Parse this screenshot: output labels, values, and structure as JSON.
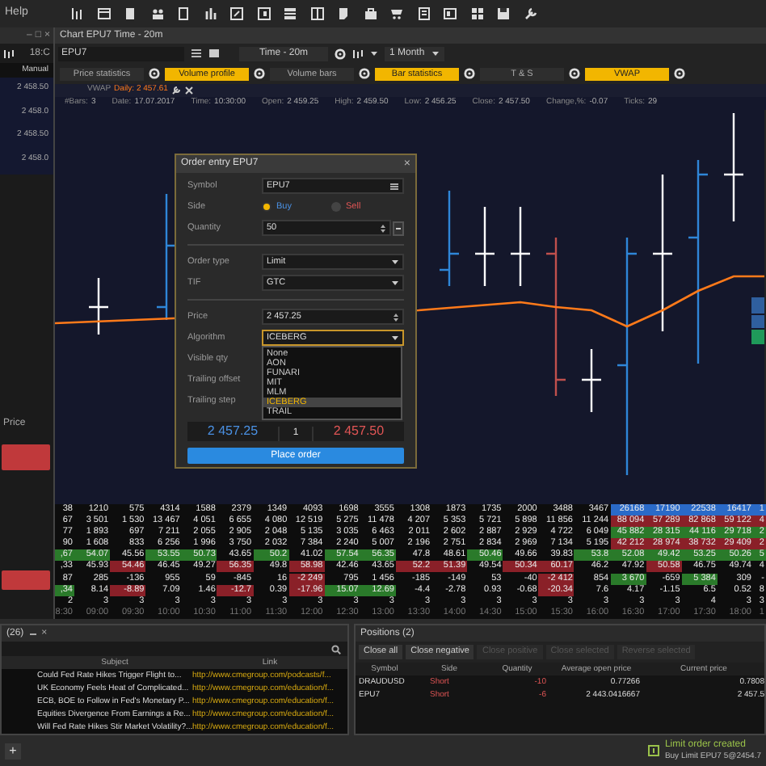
{
  "menu": {
    "label": "Help"
  },
  "left_panel": {
    "window_controls": [
      "–",
      "□",
      "×"
    ],
    "time": "18:C",
    "mode": "Manual",
    "prices": [
      "2 458.50",
      "2 458.0",
      "2 458.50",
      "2 458.0"
    ],
    "price_label": "Price"
  },
  "chart_window": {
    "title": "Chart EPU7 Time - 20m",
    "symbol": "EPU7",
    "timeframe": "Time - 20m",
    "period": "1 Month",
    "indicators": [
      {
        "label": "Price statistics",
        "on": false
      },
      {
        "label": "Volume profile",
        "on": true
      },
      {
        "label": "Volume bars",
        "on": false
      },
      {
        "label": "Bar statistics",
        "on": true
      },
      {
        "label": "T & S",
        "on": false
      },
      {
        "label": "VWAP",
        "on": true
      }
    ],
    "vwap": {
      "label": "VWAP",
      "value": "Daily: 2 457.61"
    },
    "info": [
      {
        "label": "#Bars:",
        "value": "3"
      },
      {
        "label": "Date:",
        "value": "17.07.2017"
      },
      {
        "label": "Time:",
        "value": "10:30:00"
      },
      {
        "label": "Open:",
        "value": "2 459.25"
      },
      {
        "label": "High:",
        "value": "2 459.50"
      },
      {
        "label": "Low:",
        "value": "2 456.25"
      },
      {
        "label": "Close:",
        "value": "2 457.50"
      },
      {
        "label": "Change,%:",
        "value": "-0.07"
      },
      {
        "label": "Ticks:",
        "value": "29"
      }
    ]
  },
  "stats_table": {
    "rows": [
      {
        "cells": [
          {
            "text": "38"
          },
          {
            "text": "1210"
          },
          {
            "text": "575"
          },
          {
            "text": "4314"
          },
          {
            "text": "1588"
          },
          {
            "text": "2379"
          },
          {
            "text": "1349"
          },
          {
            "text": "4093"
          },
          {
            "text": "1698"
          },
          {
            "text": "3555"
          },
          {
            "text": "1308"
          },
          {
            "text": "1873"
          },
          {
            "text": "1735"
          },
          {
            "text": "2000"
          },
          {
            "text": "3488"
          },
          {
            "text": "3467"
          },
          {
            "text": "26168",
            "color": "#2a6ac8"
          },
          {
            "text": "17190",
            "color": "#2a6ac8"
          },
          {
            "text": "22538",
            "color": "#2a6ac8"
          },
          {
            "text": "16417",
            "color": "#2a6ac8"
          },
          {
            "text": "1",
            "color": "#2a6ac8"
          }
        ]
      },
      {
        "cells": [
          {
            "text": "67"
          },
          {
            "text": "3 501"
          },
          {
            "text": "1 530"
          },
          {
            "text": "13 467"
          },
          {
            "text": "4 051"
          },
          {
            "text": "6 655"
          },
          {
            "text": "4 080"
          },
          {
            "text": "12 519"
          },
          {
            "text": "5 275"
          },
          {
            "text": "11 478"
          },
          {
            "text": "4 207"
          },
          {
            "text": "5 353"
          },
          {
            "text": "5 721"
          },
          {
            "text": "5 898"
          },
          {
            "text": "11 856"
          },
          {
            "text": "11 244"
          },
          {
            "text": "88 094",
            "color": "#8a2028"
          },
          {
            "text": "57 289",
            "color": "#8a2028"
          },
          {
            "text": "82 868",
            "color": "#8a2028"
          },
          {
            "text": "59 122",
            "color": "#8a2028"
          },
          {
            "text": "4",
            "color": "#8a2028"
          }
        ]
      },
      {
        "cells": [
          {
            "text": "77"
          },
          {
            "text": "1 893"
          },
          {
            "text": "697"
          },
          {
            "text": "7 211"
          },
          {
            "text": "2 055"
          },
          {
            "text": "2 905"
          },
          {
            "text": "2 048"
          },
          {
            "text": "5 135"
          },
          {
            "text": "3 035"
          },
          {
            "text": "6 463"
          },
          {
            "text": "2 011"
          },
          {
            "text": "2 602"
          },
          {
            "text": "2 887"
          },
          {
            "text": "2 929"
          },
          {
            "text": "4 722"
          },
          {
            "text": "6 049"
          },
          {
            "text": "45 882",
            "color": "#2a7a2a"
          },
          {
            "text": "28 315",
            "color": "#2a7a2a"
          },
          {
            "text": "44 116",
            "color": "#2a7a2a"
          },
          {
            "text": "29 718",
            "color": "#2a7a2a"
          },
          {
            "text": "2",
            "color": "#2a7a2a"
          }
        ]
      },
      {
        "cells": [
          {
            "text": "90"
          },
          {
            "text": "1 608"
          },
          {
            "text": "833"
          },
          {
            "text": "6 256"
          },
          {
            "text": "1 996"
          },
          {
            "text": "3 750"
          },
          {
            "text": "2 032"
          },
          {
            "text": "7 384"
          },
          {
            "text": "2 240"
          },
          {
            "text": "5 007"
          },
          {
            "text": "2 196"
          },
          {
            "text": "2 751"
          },
          {
            "text": "2 834"
          },
          {
            "text": "2 969"
          },
          {
            "text": "7 134"
          },
          {
            "text": "5 195"
          },
          {
            "text": "42 212",
            "color": "#8a2028"
          },
          {
            "text": "28 974",
            "color": "#8a2028"
          },
          {
            "text": "38 732",
            "color": "#8a2028"
          },
          {
            "text": "29 409",
            "color": "#8a2028"
          },
          {
            "text": "2",
            "color": "#8a2028"
          }
        ]
      },
      {
        "cells": [
          {
            "text": ",67",
            "color": "#2a7a2a"
          },
          {
            "text": "54.07",
            "color": "#2a7a2a"
          },
          {
            "text": "45.56"
          },
          {
            "text": "53.55",
            "color": "#2a7a2a"
          },
          {
            "text": "50.73",
            "color": "#2a7a2a"
          },
          {
            "text": "43.65"
          },
          {
            "text": "50.2",
            "color": "#2a7a2a"
          },
          {
            "text": "41.02"
          },
          {
            "text": "57.54",
            "color": "#2a7a2a"
          },
          {
            "text": "56.35",
            "color": "#2a7a2a"
          },
          {
            "text": "47.8"
          },
          {
            "text": "48.61"
          },
          {
            "text": "50.46",
            "color": "#2a7a2a"
          },
          {
            "text": "49.66"
          },
          {
            "text": "39.83"
          },
          {
            "text": "53.8",
            "color": "#2a7a2a"
          },
          {
            "text": "52.08",
            "color": "#2a7a2a"
          },
          {
            "text": "49.42",
            "color": "#2a7a2a"
          },
          {
            "text": "53.25",
            "color": "#2a7a2a"
          },
          {
            "text": "50.26",
            "color": "#2a7a2a"
          },
          {
            "text": "5",
            "color": "#2a7a2a"
          }
        ]
      },
      {
        "cells": [
          {
            "text": ",33"
          },
          {
            "text": "45.93"
          },
          {
            "text": "54.46",
            "color": "#8a2028"
          },
          {
            "text": "46.45"
          },
          {
            "text": "49.27"
          },
          {
            "text": "56.35",
            "color": "#8a2028"
          },
          {
            "text": "49.8"
          },
          {
            "text": "58.98",
            "color": "#8a2028"
          },
          {
            "text": "42.46"
          },
          {
            "text": "43.65"
          },
          {
            "text": "52.2",
            "color": "#8a2028"
          },
          {
            "text": "51.39",
            "color": "#8a2028"
          },
          {
            "text": "49.54"
          },
          {
            "text": "50.34",
            "color": "#8a2028"
          },
          {
            "text": "60.17",
            "color": "#8a2028"
          },
          {
            "text": "46.2"
          },
          {
            "text": "47.92"
          },
          {
            "text": "50.58",
            "color": "#8a2028"
          },
          {
            "text": "46.75"
          },
          {
            "text": "49.74"
          },
          {
            "text": "4"
          }
        ]
      },
      {
        "cells": [
          {
            "text": "87"
          },
          {
            "text": "285"
          },
          {
            "text": "-136"
          },
          {
            "text": "955"
          },
          {
            "text": "59"
          },
          {
            "text": "-845"
          },
          {
            "text": "16"
          },
          {
            "text": "-2 249",
            "color": "#8a2028"
          },
          {
            "text": "795"
          },
          {
            "text": "1 456"
          },
          {
            "text": "-185"
          },
          {
            "text": "-149"
          },
          {
            "text": "53"
          },
          {
            "text": "-40"
          },
          {
            "text": "-2 412",
            "color": "#8a2028"
          },
          {
            "text": "854"
          },
          {
            "text": "3 670",
            "color": "#2a7a2a"
          },
          {
            "text": "-659"
          },
          {
            "text": "5 384",
            "color": "#2a7a2a"
          },
          {
            "text": "309"
          },
          {
            "text": "-"
          }
        ]
      },
      {
        "cells": [
          {
            "text": ",34",
            "color": "#2a7a2a"
          },
          {
            "text": "8.14"
          },
          {
            "text": "-8.89",
            "color": "#8a2028"
          },
          {
            "text": "7.09"
          },
          {
            "text": "1.46"
          },
          {
            "text": "-12.7",
            "color": "#8a2028"
          },
          {
            "text": "0.39"
          },
          {
            "text": "-17.96",
            "color": "#8a2028"
          },
          {
            "text": "15.07",
            "color": "#2a7a2a"
          },
          {
            "text": "12.69",
            "color": "#2a7a2a"
          },
          {
            "text": "-4.4"
          },
          {
            "text": "-2.78"
          },
          {
            "text": "0.93"
          },
          {
            "text": "-0.68"
          },
          {
            "text": "-20.34",
            "color": "#8a2028"
          },
          {
            "text": "7.6"
          },
          {
            "text": "4.17"
          },
          {
            "text": "-1.15"
          },
          {
            "text": "6.5"
          },
          {
            "text": "0.52"
          },
          {
            "text": "8"
          }
        ]
      },
      {
        "cells": [
          {
            "text": "2"
          },
          {
            "text": "3"
          },
          {
            "text": "3"
          },
          {
            "text": "3"
          },
          {
            "text": "3"
          },
          {
            "text": "3"
          },
          {
            "text": "3"
          },
          {
            "text": "3"
          },
          {
            "text": "3"
          },
          {
            "text": "3"
          },
          {
            "text": "3"
          },
          {
            "text": "3"
          },
          {
            "text": "3"
          },
          {
            "text": "3"
          },
          {
            "text": "3"
          },
          {
            "text": "3"
          },
          {
            "text": "3"
          },
          {
            "text": "3"
          },
          {
            "text": "4"
          },
          {
            "text": "3"
          },
          {
            "text": "3"
          }
        ]
      },
      {
        "cells": [
          {
            "text": "8:30"
          },
          {
            "text": "09:00"
          },
          {
            "text": "09:30"
          },
          {
            "text": "10:00"
          },
          {
            "text": "10:30"
          },
          {
            "text": "11:00"
          },
          {
            "text": "11:30"
          },
          {
            "text": "12:00"
          },
          {
            "text": "12:30"
          },
          {
            "text": "13:00"
          },
          {
            "text": "13:30"
          },
          {
            "text": "14:00"
          },
          {
            "text": "14:30"
          },
          {
            "text": "15:00"
          },
          {
            "text": "15:30"
          },
          {
            "text": "16:00"
          },
          {
            "text": "16:30"
          },
          {
            "text": "17:00"
          },
          {
            "text": "17:30"
          },
          {
            "text": "18:00"
          },
          {
            "text": "1"
          }
        ]
      }
    ]
  },
  "order_entry": {
    "title": "Order entry EPU7",
    "close": "×",
    "symbol": {
      "label": "Symbol",
      "value": "EPU7"
    },
    "side": {
      "label": "Side",
      "options": [
        {
          "label": "Buy",
          "selected": true
        },
        {
          "label": "Sell",
          "selected": false
        }
      ]
    },
    "quantity": {
      "label": "Quantity",
      "value": "50"
    },
    "order_type": {
      "label": "Order type",
      "value": "Limit"
    },
    "tif": {
      "label": "TIF",
      "value": "GTC"
    },
    "price": {
      "label": "Price",
      "value": "2 457.25"
    },
    "algorithm": {
      "label": "Algorithm",
      "value": "ICEBERG",
      "expanded": true,
      "options": [
        {
          "label": "None",
          "selected": false
        },
        {
          "label": "AON",
          "selected": false
        },
        {
          "label": "FUNARI",
          "selected": false
        },
        {
          "label": "MIT",
          "selected": false
        },
        {
          "label": "MLM",
          "selected": false
        },
        {
          "label": "ICEBERG",
          "selected": true
        },
        {
          "label": "TRAIL",
          "selected": false
        }
      ]
    },
    "hidden_labels": [
      "Visible qty",
      "Trailing offset",
      "Trailing step"
    ],
    "bid": "2 457.25",
    "spread": "1",
    "ask": "2 457.50",
    "submit": "Place order"
  },
  "news": {
    "tab": "(26)",
    "close": "×",
    "columns": [
      "Subject",
      "Link"
    ],
    "rows": [
      {
        "subject": "Could Fed Rate Hikes Trigger Flight to...",
        "link": "http://www.cmegroup.com/podcasts/f..."
      },
      {
        "subject": "UK Economy Feels Heat of Complicated...",
        "link": "http://www.cmegroup.com/education/f..."
      },
      {
        "subject": "ECB, BOE to Follow in Fed's Monetary P...",
        "link": "http://www.cmegroup.com/education/f..."
      },
      {
        "subject": "Equities Divergence From Earnings a Re...",
        "link": "http://www.cmegroup.com/education/f..."
      },
      {
        "subject": "Will Fed Rate Hikes Stir Market Volatility?...",
        "link": "http://www.cmegroup.com/education/f..."
      }
    ]
  },
  "positions": {
    "title": "Positions (2)",
    "buttons": [
      {
        "label": "Close all",
        "disabled": false
      },
      {
        "label": "Close negative",
        "disabled": false
      },
      {
        "label": "Close positive",
        "disabled": true
      },
      {
        "label": "Close selected",
        "disabled": true
      },
      {
        "label": "Reverse selected",
        "disabled": true
      }
    ],
    "columns": [
      "Symbol",
      "Side",
      "Quantity",
      "Average open price",
      "Current price"
    ],
    "rows": [
      {
        "symbol": "DRAUDUSD",
        "side": "Short",
        "quantity": "-10",
        "avg_price": "0.77266",
        "current_price": "0.7808"
      },
      {
        "symbol": "EPU7",
        "side": "Short",
        "quantity": "-6",
        "avg_price": "2 443.0416667",
        "current_price": "2 457.5"
      }
    ]
  },
  "status_bar": {
    "add": "+",
    "notification": {
      "title": "Limit order created",
      "detail": "Buy Limit EPU7 5@2454.7"
    }
  }
}
